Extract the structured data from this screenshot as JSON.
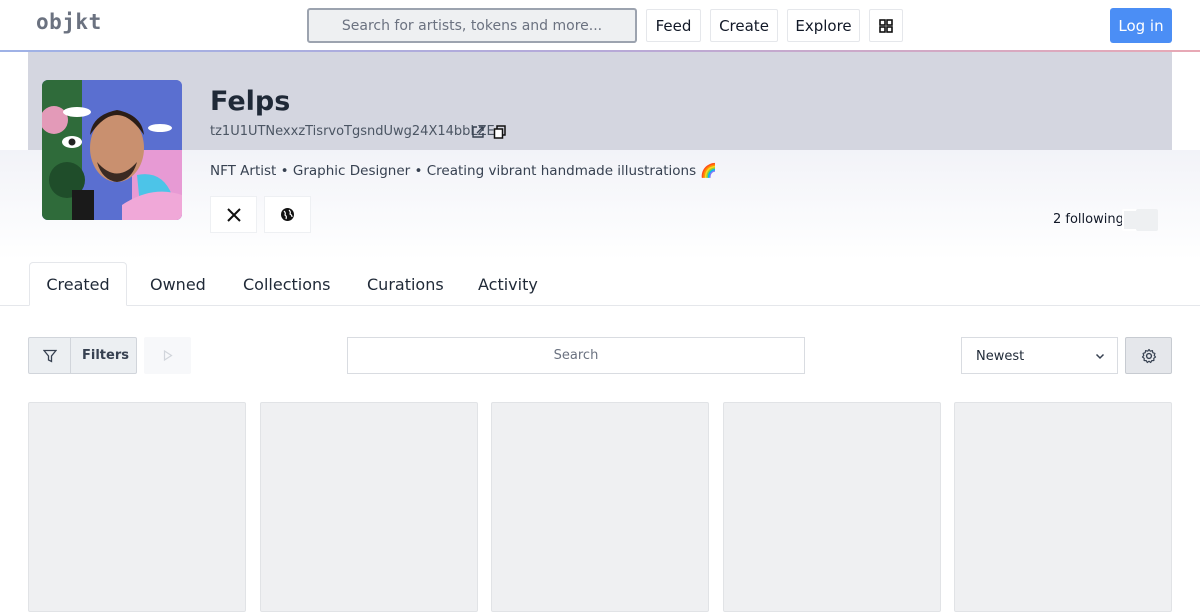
{
  "logo": "objkt",
  "search": {
    "placeholder": "Search for artists, tokens and more..."
  },
  "nav": {
    "feed": "Feed",
    "create": "Create",
    "explore": "Explore",
    "login": "Log in"
  },
  "profile": {
    "name": "Felps",
    "address": "tz1U1UTNexxzTisrvoTgsndUwg24X14bbLZE",
    "bio": "NFT Artist • Graphic Designer • Creating vibrant handmade illustrations 🌈",
    "following": "2 following"
  },
  "tabs": [
    "Created",
    "Owned",
    "Collections",
    "Curations",
    "Activity"
  ],
  "toolbar": {
    "filters_label": "Filters",
    "search_placeholder": "Search",
    "sort_selected": "Newest"
  },
  "colors": {
    "accent": "#4b8ef5",
    "card_bg": "#eff0f2"
  },
  "icons": [
    "filter-icon",
    "play-icon",
    "chevron-down-icon",
    "gear-icon",
    "x-icon",
    "globe-icon",
    "external-link-icon",
    "copy-icon",
    "grid-icon"
  ]
}
